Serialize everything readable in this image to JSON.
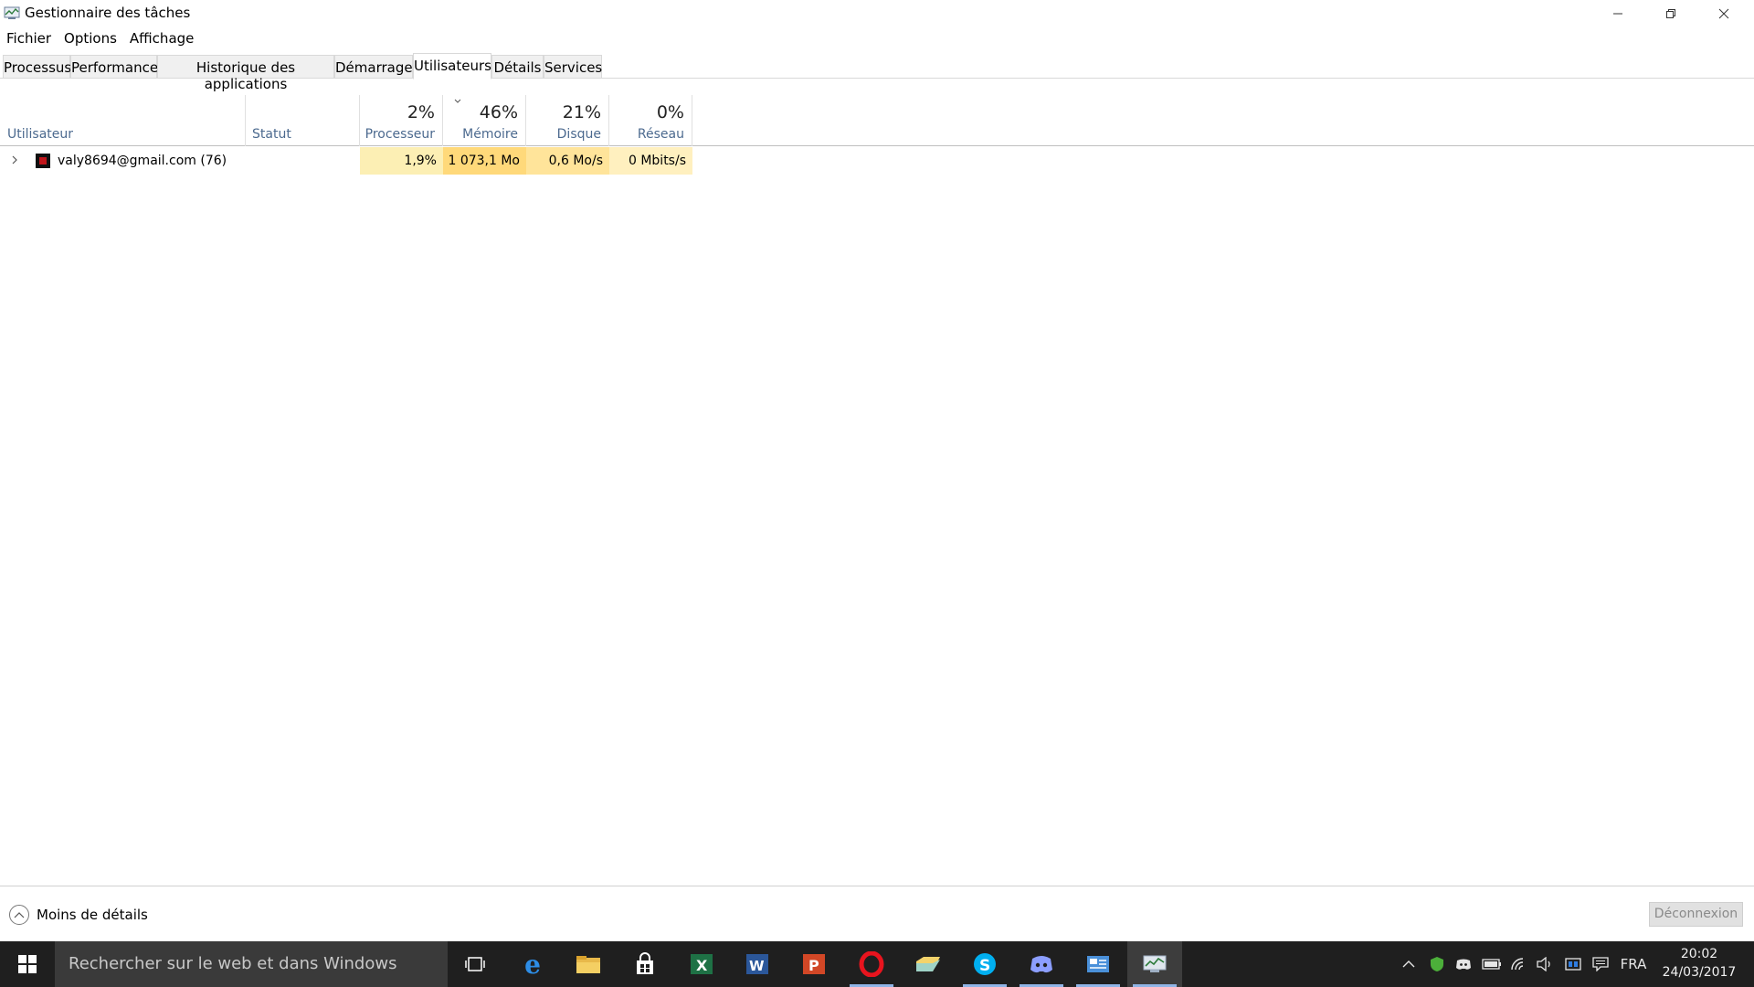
{
  "window": {
    "title": "Gestionnaire des tâches"
  },
  "menu": {
    "items": [
      {
        "label": "Fichier"
      },
      {
        "label": "Options"
      },
      {
        "label": "Affichage"
      }
    ]
  },
  "tabs": [
    {
      "label": "Processus"
    },
    {
      "label": "Performance"
    },
    {
      "label": "Historique des applications"
    },
    {
      "label": "Démarrage"
    },
    {
      "label": "Utilisateurs",
      "active": true
    },
    {
      "label": "Détails"
    },
    {
      "label": "Services"
    }
  ],
  "columns": {
    "user": {
      "label": "Utilisateur"
    },
    "status": {
      "label": "Statut"
    },
    "cpu": {
      "label": "Processeur",
      "total": "2%"
    },
    "memory": {
      "label": "Mémoire",
      "total": "46%",
      "sorted": true
    },
    "disk": {
      "label": "Disque",
      "total": "21%"
    },
    "network": {
      "label": "Réseau",
      "total": "0%"
    }
  },
  "rows": [
    {
      "user": "valy8694@gmail.com (76)",
      "status": "",
      "cpu": "1,9%",
      "memory": "1 073,1 Mo",
      "disk": "0,6 Mo/s",
      "network": "0 Mbits/s"
    }
  ],
  "heat_colors": {
    "cpu": "#fcefb4",
    "memory": "#ffd97a",
    "disk": "#ffe49a",
    "network": "#fff0bf"
  },
  "footer": {
    "less_details_label": "Moins de détails",
    "disconnect_label": "Déconnexion"
  },
  "taskbar": {
    "search_placeholder": "Rechercher sur le web et dans Windows",
    "apps": [
      "task-view-icon",
      "edge-icon",
      "file-explorer-icon",
      "store-icon",
      "excel-icon",
      "word-icon",
      "powerpoint-icon",
      "opera-icon",
      "folder-sync-icon",
      "skype-icon",
      "discord-icon",
      "control-panel-icon",
      "task-manager-icon"
    ],
    "language": "FRA",
    "time": "20:02",
    "date": "24/03/2017"
  }
}
